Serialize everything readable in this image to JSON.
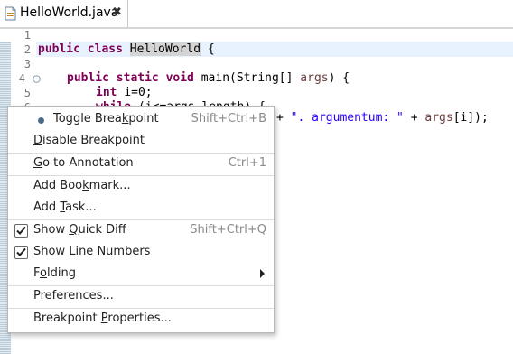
{
  "tab": {
    "title": "HelloWorld.java",
    "close_glyph": "✖"
  },
  "editor": {
    "line_numbers": [
      "1",
      "2",
      "3",
      "4",
      "5",
      "6"
    ],
    "lines": {
      "l2": {
        "kw": "public class ",
        "name": "HelloWorld",
        "rest": " {"
      },
      "l4": {
        "kw": "public static void ",
        "rest": "main(String[] ",
        "var": "args",
        "end": ") {"
      },
      "l5": {
        "kw": "int ",
        "rest": "i=0;"
      },
      "l6": {
        "kw": "while ",
        "rest": "(i<=args.length) {"
      },
      "l7": {
        "a": "+ ",
        "str": "\". argumentum: \"",
        "b": " + ",
        "var": "args",
        "c": "[i]);"
      }
    }
  },
  "menu": {
    "items": [
      {
        "label_pre": "Toggle Brea",
        "mnemonic": "k",
        "label_post": "point",
        "accel": "Shift+Ctrl+B"
      },
      {
        "label_pre": "",
        "mnemonic": "D",
        "label_post": "isable Breakpoint",
        "accel": ""
      },
      {
        "label_pre": "",
        "mnemonic": "G",
        "label_post": "o to Annotation",
        "accel": "Ctrl+1"
      },
      {
        "label_pre": "Add Boo",
        "mnemonic": "k",
        "label_post": "mark...",
        "accel": ""
      },
      {
        "label_pre": "Add ",
        "mnemonic": "T",
        "label_post": "ask...",
        "accel": ""
      },
      {
        "label_pre": "Show ",
        "mnemonic": "Q",
        "label_post": "uick Diff",
        "accel": "Shift+Ctrl+Q",
        "checked": true
      },
      {
        "label_pre": "Show Line ",
        "mnemonic": "N",
        "label_post": "umbers",
        "accel": "",
        "checked": true
      },
      {
        "label_pre": "F",
        "mnemonic": "o",
        "label_post": "lding",
        "accel": ""
      },
      {
        "label_pre": "Preferences...",
        "mnemonic": "",
        "label_post": "",
        "accel": ""
      },
      {
        "label_pre": "Breakpoint ",
        "mnemonic": "P",
        "label_post": "roperties...",
        "accel": ""
      }
    ]
  }
}
